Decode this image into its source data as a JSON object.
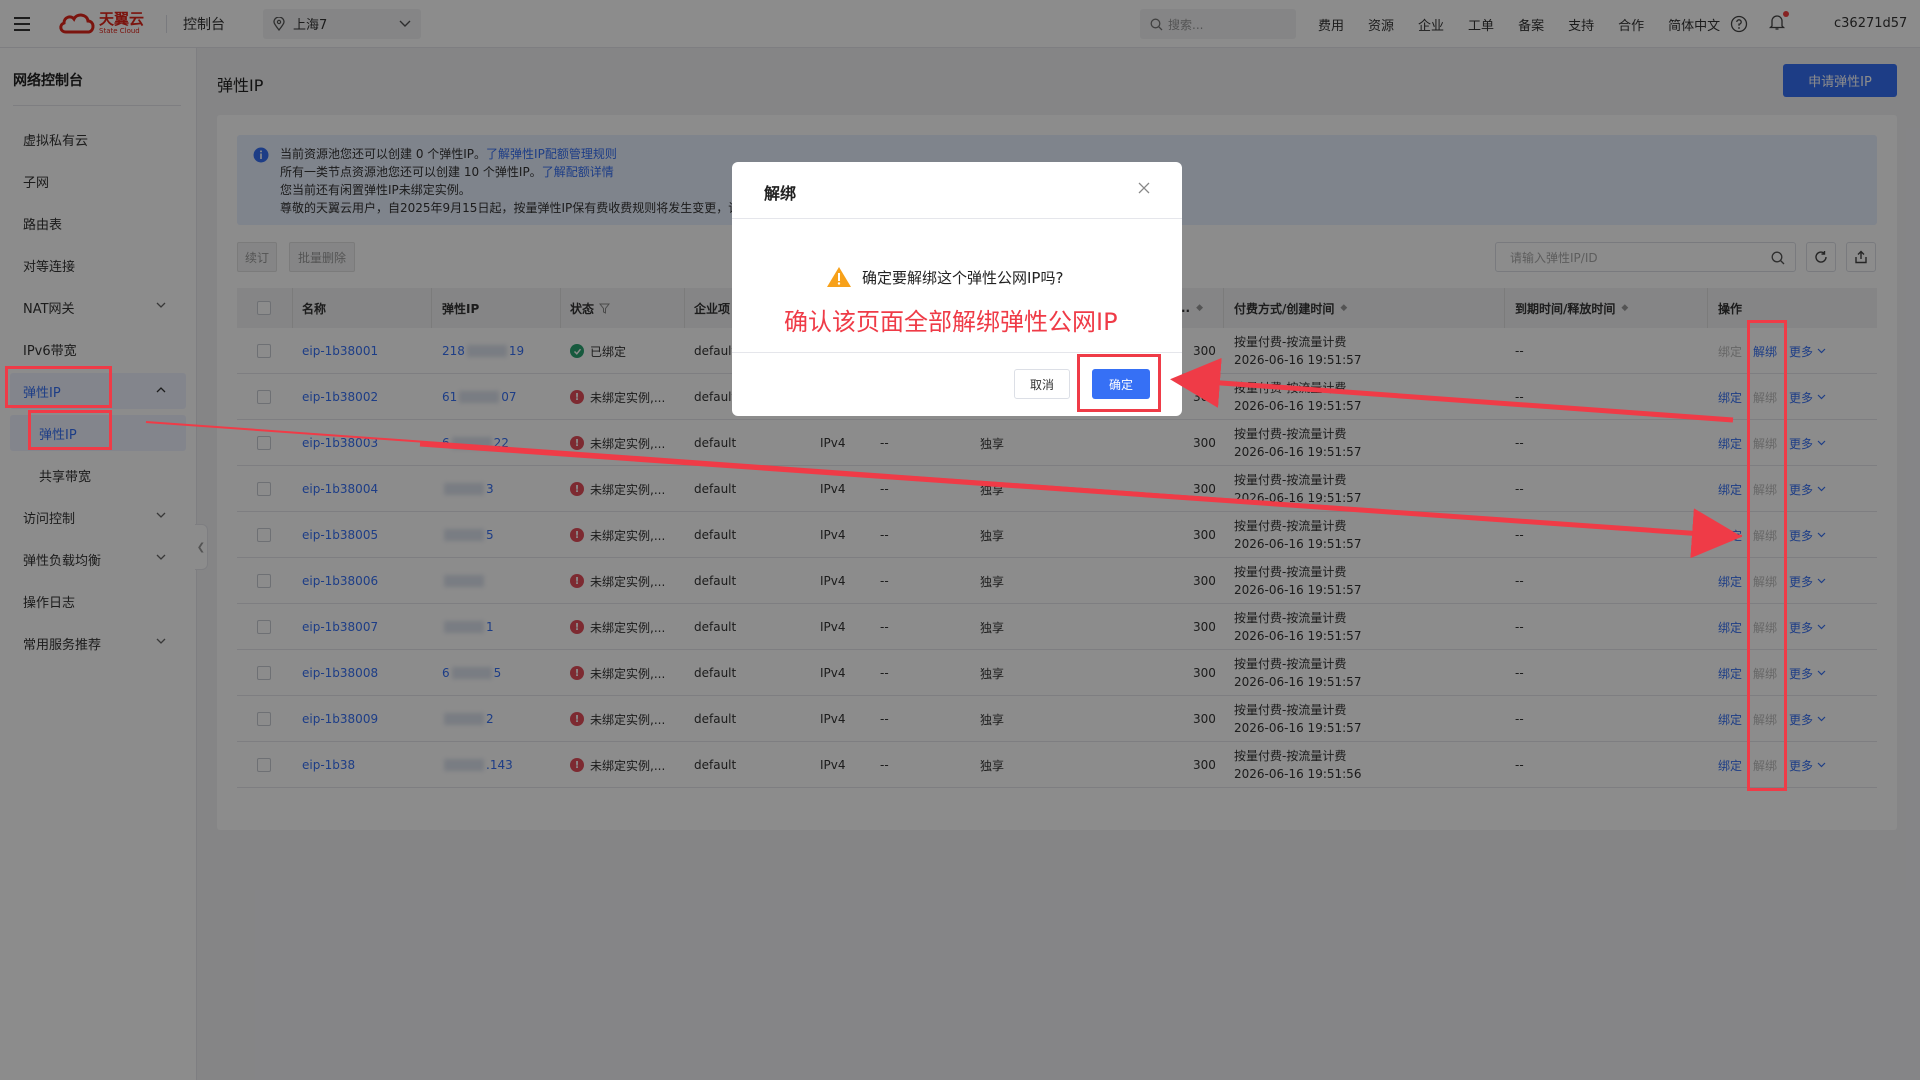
{
  "topbar": {
    "logo_cn": "天翼云",
    "logo_en": "State Cloud",
    "console": "控制台",
    "region": "上海7",
    "search_placeholder": "搜索...",
    "links": [
      "费用",
      "资源",
      "企业",
      "工单",
      "备案",
      "支持",
      "合作",
      "简体中文"
    ],
    "user": "c36271d57"
  },
  "sidebar": {
    "title": "网络控制台",
    "items": [
      "虚拟私有云",
      "子网",
      "路由表",
      "对等连接",
      "NAT网关",
      "IPv6带宽",
      "弹性IP",
      "弹性IP",
      "共享带宽",
      "访问控制",
      "弹性负载均衡",
      "操作日志",
      "常用服务推荐"
    ]
  },
  "main": {
    "page_title": "弹性IP",
    "apply_button": "申请弹性IP",
    "notice": {
      "line1_text": "当前资源池您还可以创建 0 个弹性IP。",
      "line1_link": "了解弹性IP配额管理规则",
      "line2_text": "所有一类节点资源池您还可以创建 10 个弹性IP。",
      "line2_link": "了解配额详情",
      "line3": "您当前还有闲置弹性IP未绑定实例。",
      "line4": "尊敬的天翼云用户，自2025年9月15日起，按量弹性IP保有费收费规则将发生变更，详"
    },
    "renew_button": "续订",
    "batch_delete_button": "批量删除",
    "search_placeholder": "请输入弹性IP/ID",
    "headers": {
      "name": "名称",
      "ip": "弹性IP",
      "status": "状态",
      "enterprise": "企业项",
      "bandwidth": "..",
      "pay": "付费方式/创建时间",
      "expire": "到期时间/释放时间",
      "ops": "操作"
    },
    "rows": [
      {
        "name": "eip-1b38001",
        "ip_prefix": "218",
        "ip_suffix": "19",
        "status": "已绑定",
        "bound": true,
        "enterprise": "default",
        "ipver": "",
        "dash": "",
        "share": "",
        "bw": "300",
        "pay": "按量付费-按流量计费",
        "created": "2026-06-16 19:51:57",
        "expire": "--"
      },
      {
        "name": "eip-1b38002",
        "ip_prefix": "61",
        "ip_suffix": "07",
        "status": "未绑定实例,...",
        "bound": false,
        "enterprise": "default",
        "ipver": "",
        "dash": "",
        "share": "",
        "bw": "300",
        "pay": "按量付费-按流量计费",
        "created": "2026-06-16 19:51:57",
        "expire": "--"
      },
      {
        "name": "eip-1b38003",
        "ip_prefix": "6",
        "ip_suffix": "22",
        "status": "未绑定实例,...",
        "bound": false,
        "enterprise": "default",
        "ipver": "IPv4",
        "dash": "--",
        "share": "独享",
        "bw": "300",
        "pay": "按量付费-按流量计费",
        "created": "2026-06-16 19:51:57",
        "expire": "--"
      },
      {
        "name": "eip-1b38004",
        "ip_prefix": "",
        "ip_suffix": "3",
        "status": "未绑定实例,...",
        "bound": false,
        "enterprise": "default",
        "ipver": "IPv4",
        "dash": "--",
        "share": "独享",
        "bw": "300",
        "pay": "按量付费-按流量计费",
        "created": "2026-06-16 19:51:57",
        "expire": "--"
      },
      {
        "name": "eip-1b38005",
        "ip_prefix": "",
        "ip_suffix": "5",
        "status": "未绑定实例,...",
        "bound": false,
        "enterprise": "default",
        "ipver": "IPv4",
        "dash": "--",
        "share": "独享",
        "bw": "300",
        "pay": "按量付费-按流量计费",
        "created": "2026-06-16 19:51:57",
        "expire": "--"
      },
      {
        "name": "eip-1b38006",
        "ip_prefix": "",
        "ip_suffix": "",
        "status": "未绑定实例,...",
        "bound": false,
        "enterprise": "default",
        "ipver": "IPv4",
        "dash": "--",
        "share": "独享",
        "bw": "300",
        "pay": "按量付费-按流量计费",
        "created": "2026-06-16 19:51:57",
        "expire": "--"
      },
      {
        "name": "eip-1b38007",
        "ip_prefix": "",
        "ip_suffix": "1",
        "status": "未绑定实例,...",
        "bound": false,
        "enterprise": "default",
        "ipver": "IPv4",
        "dash": "--",
        "share": "独享",
        "bw": "300",
        "pay": "按量付费-按流量计费",
        "created": "2026-06-16 19:51:57",
        "expire": "--"
      },
      {
        "name": "eip-1b38008",
        "ip_prefix": "6",
        "ip_suffix": "5",
        "status": "未绑定实例,...",
        "bound": false,
        "enterprise": "default",
        "ipver": "IPv4",
        "dash": "--",
        "share": "独享",
        "bw": "300",
        "pay": "按量付费-按流量计费",
        "created": "2026-06-16 19:51:57",
        "expire": "--"
      },
      {
        "name": "eip-1b38009",
        "ip_prefix": "",
        "ip_suffix": "2",
        "status": "未绑定实例,...",
        "bound": false,
        "enterprise": "default",
        "ipver": "IPv4",
        "dash": "--",
        "share": "独享",
        "bw": "300",
        "pay": "按量付费-按流量计费",
        "created": "2026-06-16 19:51:57",
        "expire": "--"
      },
      {
        "name": "eip-1b38",
        "ip_prefix": "",
        "ip_suffix": ".143",
        "status": "未绑定实例,...",
        "bound": false,
        "enterprise": "default",
        "ipver": "IPv4",
        "dash": "--",
        "share": "独享",
        "bw": "300",
        "pay": "按量付费-按流量计费",
        "created": "2026-06-16 19:51:56",
        "expire": "--"
      }
    ],
    "op_bind": "绑定",
    "op_unbind": "解绑",
    "op_more": "更多"
  },
  "modal": {
    "title": "解绑",
    "question": "确定要解绑这个弹性公网IP吗?",
    "annotation": "确认该页面全部解绑弹性公网IP",
    "cancel": "取消",
    "confirm": "确定"
  },
  "colors": {
    "primary": "#3670f5",
    "annotation_red": "#ef3b47",
    "success": "#2ba471",
    "error": "#e34d59",
    "warning": "#f7a11a"
  }
}
